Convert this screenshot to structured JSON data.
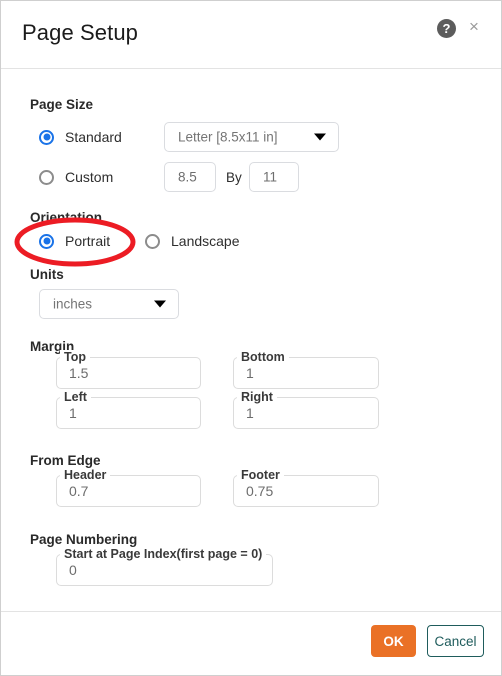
{
  "dialog": {
    "title": "Page Setup",
    "help_icon": "help-icon",
    "close_icon": "close-icon",
    "help_glyph": "?",
    "close_glyph": "×"
  },
  "page_size": {
    "section_label": "Page Size",
    "standard": {
      "label": "Standard",
      "selected": true,
      "dropdown_value": "Letter [8.5x11 in]"
    },
    "custom": {
      "label": "Custom",
      "selected": false,
      "width_value": "8.5",
      "by_label": "By",
      "height_value": "11"
    }
  },
  "orientation": {
    "section_label": "Orientation",
    "portrait": {
      "label": "Portrait",
      "selected": true
    },
    "landscape": {
      "label": "Landscape",
      "selected": false
    }
  },
  "units": {
    "section_label": "Units",
    "value": "inches"
  },
  "margin": {
    "section_label": "Margin",
    "fields": [
      {
        "label": "Top",
        "value": "1.5"
      },
      {
        "label": "Bottom",
        "value": "1"
      },
      {
        "label": "Left",
        "value": "1"
      },
      {
        "label": "Right",
        "value": "1"
      }
    ]
  },
  "from_edge": {
    "section_label": "From Edge",
    "fields": [
      {
        "label": "Header",
        "value": "0.7"
      },
      {
        "label": "Footer",
        "value": "0.75"
      }
    ]
  },
  "page_numbering": {
    "section_label": "Page Numbering",
    "field": {
      "label": "Start at Page Index(first page = 0)",
      "value": "0"
    }
  },
  "footer": {
    "ok_label": "OK",
    "cancel_label": "Cancel"
  },
  "annotation": {
    "shape": "ellipse-highlight",
    "target": "Portrait",
    "color": "#ec1c24"
  },
  "colors": {
    "accent_blue": "#1a73e8",
    "ok_orange": "#ea7126",
    "cancel_teal": "#1f5c5c",
    "annotation_red": "#ec1c24"
  }
}
